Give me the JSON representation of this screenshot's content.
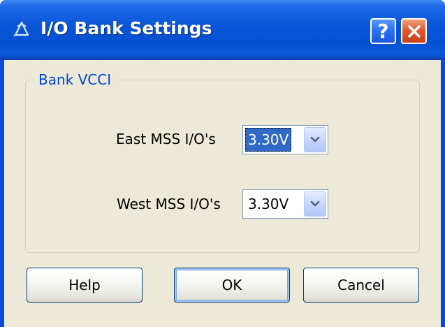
{
  "window": {
    "title": "I/O Bank Settings",
    "title_icon": "tri-arrow-logo-icon",
    "help_label": "?",
    "close_icon": "close-icon"
  },
  "group": {
    "legend": "Bank VCCI",
    "fields": [
      {
        "label": "East MSS I/O's",
        "value": "3.30V",
        "focused": true
      },
      {
        "label": "West MSS I/O's",
        "value": "3.30V",
        "focused": false
      }
    ]
  },
  "buttons": {
    "help": "Help",
    "ok": "OK",
    "cancel": "Cancel"
  },
  "colors": {
    "title_bar": "#0451d2",
    "legend_text": "#0046d5",
    "selection": "#316ac5",
    "dialog_bg": "#ece9d8"
  }
}
